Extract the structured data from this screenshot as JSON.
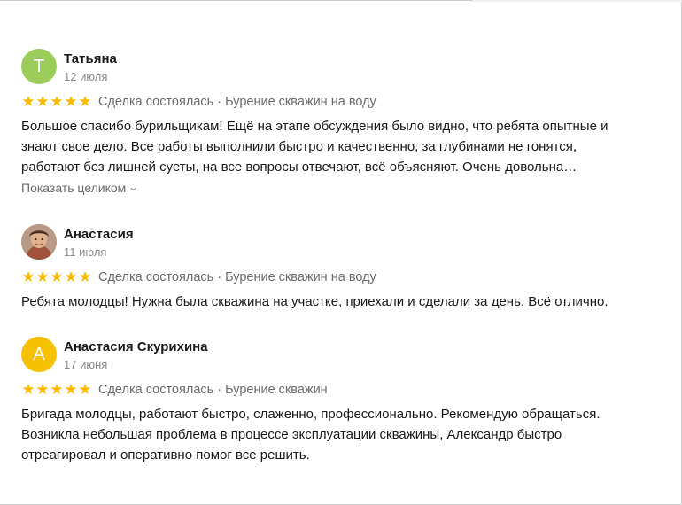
{
  "reviews": [
    {
      "author": "Татьяна",
      "avatar_letter": "Т",
      "avatar_color": "#9ccc5a",
      "date": "12 июля",
      "rating": 5,
      "deal_text": "Сделка состоялась · Бурение скважин на воду",
      "text_lines": [
        "Большое спасибо бурильщикам! Ещё на этапе обсуждения было видно, что ребята опытные и",
        "знают свое дело. Все работы выполнили быстро и качественно, за глубинами не гонятся,",
        "работают без лишней суеты, на все вопросы отвечают, всё объясняют. Очень довольна…"
      ],
      "show_more_label": "Показать целиком"
    },
    {
      "author": "Анастасия",
      "avatar_letter": "",
      "avatar_color": "#c08a6a",
      "date": "11 июля",
      "rating": 5,
      "deal_text": "Сделка состоялась · Бурение скважин на воду",
      "text_lines": [
        "Ребята молодцы! Нужна была скважина на участке, приехали и сделали за день. Всё отлично."
      ]
    },
    {
      "author": "Анастасия Скурихина",
      "avatar_letter": "А",
      "avatar_color": "#f6c100",
      "date": "17 июня",
      "rating": 5,
      "deal_text": "Сделка состоялась · Бурение скважин",
      "text_lines": [
        "Бригада молодцы, работают быстро, слаженно, профессионально. Рекомендую обращаться.",
        "Возникла небольшая проблема в процессе эксплуатации скважины, Александр быстро",
        "отреагировал и оперативно помог все решить."
      ]
    }
  ],
  "icons": {
    "star": "star-icon",
    "chevron": "chevron-down-icon"
  }
}
